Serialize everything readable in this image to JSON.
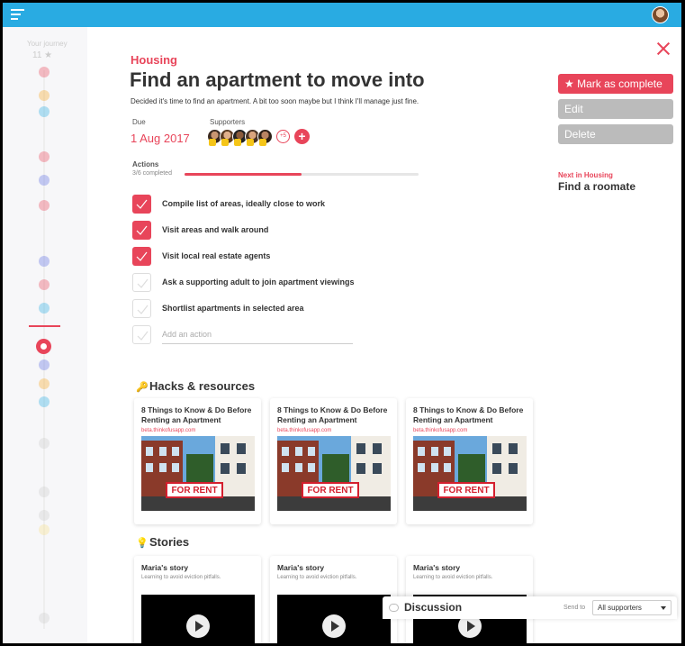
{
  "app": {
    "menu_icon": "hamburger-icon",
    "accent": "#e8455a",
    "topbar_color": "#29abe2"
  },
  "sidebar": {
    "journey_label": "Your journey",
    "journey_count": "11 ★"
  },
  "task": {
    "category": "Housing",
    "title": "Find an apartment to move into",
    "description": "Decided it's time to find an apartment. A bit too soon maybe but I think I'll manage just fine.",
    "due_label": "Due",
    "due_value": "1 Aug 2017",
    "supporters_label": "Supporters",
    "supporters_more": "+5",
    "supporters_add": "+",
    "actions_label": "Actions",
    "actions_count": "3/6 completed",
    "progress": 0.5
  },
  "actions": [
    {
      "label": "Compile list of areas, ideally close to work",
      "done": true
    },
    {
      "label": "Visit areas and walk around",
      "done": true
    },
    {
      "label": "Visit local real estate agents",
      "done": true
    },
    {
      "label": "Ask a supporting adult to join apartment viewings",
      "done": false
    },
    {
      "label": "Shortlist apartments in selected area",
      "done": false
    }
  ],
  "add_action_placeholder": "Add an action",
  "side": {
    "complete_label": "★ Mark as complete",
    "edit_label": "Edit",
    "delete_label": "Delete",
    "next_label": "Next in Housing",
    "next_value": "Find a roomate"
  },
  "hacks": {
    "title": "Hacks & resources",
    "cards": [
      {
        "title": "8 Things to Know & Do Before Renting an Apartment",
        "url": "beta.thinkofusapp.com",
        "sign": "FOR RENT"
      },
      {
        "title": "8 Things to Know & Do Before Renting an Apartment",
        "url": "beta.thinkofusapp.com",
        "sign": "FOR RENT"
      },
      {
        "title": "8 Things to Know & Do Before Renting an Apartment",
        "url": "beta.thinkofusapp.com",
        "sign": "FOR RENT"
      }
    ]
  },
  "stories": {
    "title": "Stories",
    "items": [
      {
        "title": "Maria's story",
        "subtitle": "Learning to avoid eviction pitfalls."
      },
      {
        "title": "Maria's story",
        "subtitle": "Learning to avoid eviction pitfalls."
      },
      {
        "title": "Maria's story",
        "subtitle": "Learning to avoid eviction pitfalls."
      }
    ]
  },
  "discussion": {
    "title": "Discussion",
    "send_to_label": "Send to",
    "send_to_value": "All supporters"
  }
}
